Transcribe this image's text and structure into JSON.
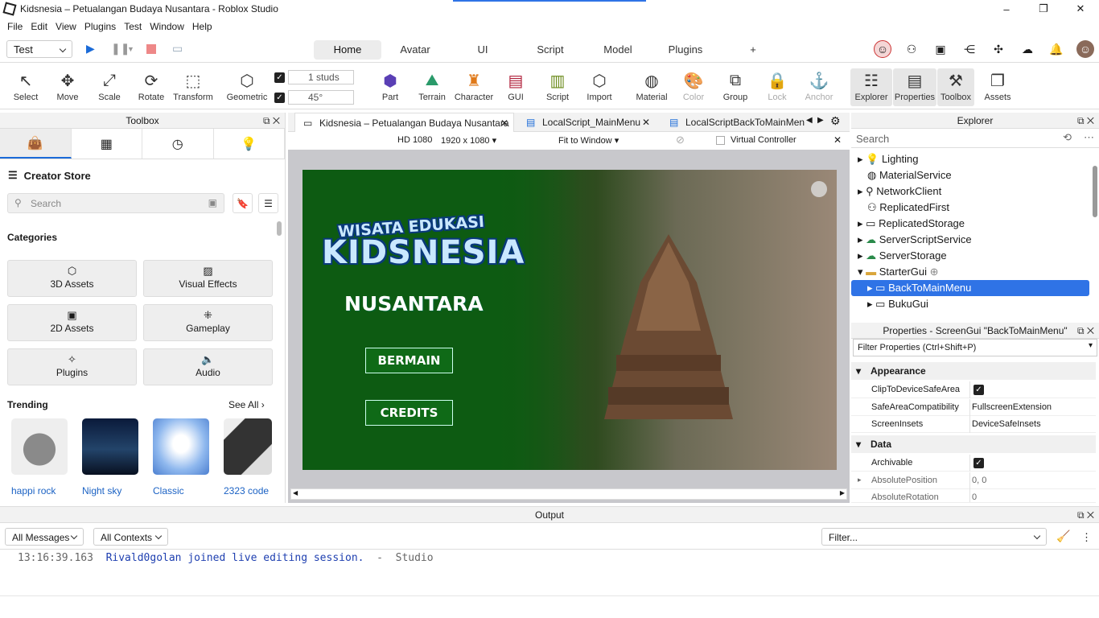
{
  "window": {
    "title": "Kidsnesia – Petualangan Budaya Nusantara - Roblox Studio",
    "minimize": "–",
    "maximize": "❐",
    "close": "✕"
  },
  "menu": [
    "File",
    "Edit",
    "View",
    "Plugins",
    "Test",
    "Window",
    "Help"
  ],
  "ribbon": {
    "mode": "Test",
    "tabs": [
      "Home",
      "Avatar",
      "UI",
      "Script",
      "Model",
      "Plugins",
      "+"
    ],
    "active_tab": "Home"
  },
  "toolbar": {
    "tools": [
      "Select",
      "Move",
      "Scale",
      "Rotate",
      "Transform",
      "Geometric",
      "Part",
      "Terrain",
      "Character",
      "GUI",
      "Script",
      "Import",
      "Material",
      "Color",
      "Group",
      "Lock",
      "Anchor",
      "Explorer",
      "Properties",
      "Toolbox",
      "Assets"
    ],
    "move_step": "1 studs",
    "rotate_step": "45°"
  },
  "toolbox": {
    "title": "Toolbox",
    "store": "Creator Store",
    "search_placeholder": "Search",
    "categories_title": "Categories",
    "categories": [
      "3D Assets",
      "Visual Effects",
      "2D Assets",
      "Gameplay",
      "Plugins",
      "Audio"
    ],
    "trending_title": "Trending",
    "see_all": "See All",
    "trending": [
      "happi rock",
      "Night sky",
      "Classic",
      "2323 code"
    ]
  },
  "viewport": {
    "tabs": [
      "Kidsnesia – Petualangan Budaya Nusantara",
      "LocalScript_MainMenu",
      "LocalScriptBackToMainMenu"
    ],
    "resolution": "HD 1080",
    "size": "1920 x 1080",
    "fit": "Fit to Window",
    "virtual_controller": "Virtual Controller"
  },
  "game": {
    "title_top": "WISATA EDUKASI",
    "title_main": "KIDSNESIA",
    "subtitle": "NUSANTARA",
    "play_button": "BERMAIN",
    "credits_button": "CREDITS"
  },
  "explorer": {
    "title": "Explorer",
    "search_placeholder": "Search",
    "items": [
      "Lighting",
      "MaterialService",
      "NetworkClient",
      "ReplicatedFirst",
      "ReplicatedStorage",
      "ServerScriptService",
      "ServerStorage",
      "StarterGui",
      "BackToMainMenu",
      "BukuGui"
    ],
    "selected": "BackToMainMenu"
  },
  "properties": {
    "title": "Properties - ScreenGui \"BackToMainMenu\"",
    "filter_placeholder": "Filter Properties (Ctrl+Shift+P)",
    "sections": [
      "Appearance",
      "Data"
    ],
    "rows": [
      {
        "name": "ClipToDeviceSafeArea",
        "value": "checked"
      },
      {
        "name": "SafeAreaCompatibility",
        "value": "FullscreenExtension"
      },
      {
        "name": "ScreenInsets",
        "value": "DeviceSafeInsets"
      },
      {
        "name": "Archivable",
        "value": "checked"
      },
      {
        "name": "AbsolutePosition",
        "value": "0, 0"
      },
      {
        "name": "AbsoluteRotation",
        "value": "0"
      }
    ]
  },
  "output": {
    "title": "Output",
    "messages_filter": "All Messages",
    "contexts_filter": "All Contexts",
    "filter_placeholder": "Filter...",
    "log_time": "13:16:39.163",
    "log_message": "Rivald0golan joined live editing session.",
    "log_sep": "-",
    "log_source": "Studio"
  },
  "colors": {
    "accent": "#2f73e6",
    "game_green": "#0d5b12"
  }
}
